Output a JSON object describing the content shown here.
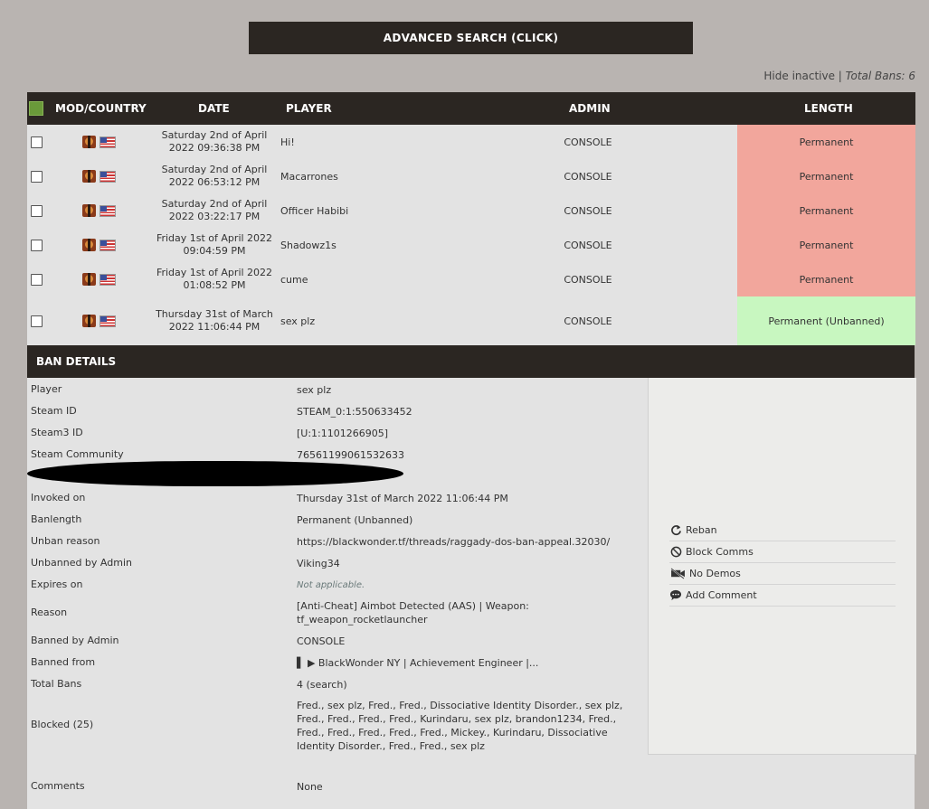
{
  "search": {
    "advanced_label": "ADVANCED SEARCH (CLICK)"
  },
  "topinfo": {
    "hide_inactive": "Hide inactive",
    "separator": " | ",
    "total_bans": "Total Bans: 6"
  },
  "table": {
    "headers": {
      "mod_country": "MOD/COUNTRY",
      "date": "DATE",
      "player": "PLAYER",
      "admin": "ADMIN",
      "length": "LENGTH"
    },
    "rows": [
      {
        "date": "Saturday 2nd of April 2022 09:36:38 PM",
        "player": "Hi!",
        "admin": "CONSOLE",
        "length": "Permanent"
      },
      {
        "date": "Saturday 2nd of April 2022 06:53:12 PM",
        "player": "Macarrones",
        "admin": "CONSOLE",
        "length": "Permanent"
      },
      {
        "date": "Saturday 2nd of April 2022 03:22:17 PM",
        "player": "Officer Habibi",
        "admin": "CONSOLE",
        "length": "Permanent"
      },
      {
        "date": "Friday 1st of April 2022 09:04:59 PM",
        "player": "Shadowz1s",
        "admin": "CONSOLE",
        "length": "Permanent"
      },
      {
        "date": "Friday 1st of April 2022 01:08:52 PM",
        "player": "cume",
        "admin": "CONSOLE",
        "length": "Permanent"
      },
      {
        "date": "Thursday 31st of March 2022 11:06:44 PM",
        "player": "sex plz",
        "admin": "CONSOLE",
        "length": "Permanent (Unbanned)"
      }
    ]
  },
  "ban_details": {
    "title": "BAN DETAILS",
    "player_label": "Player",
    "player": "sex plz",
    "steamid_label": "Steam ID",
    "steamid": "STEAM_0:1:550633452",
    "steam3_label": "Steam3 ID",
    "steam3": "[U:1:1101266905]",
    "community_label": "Steam Community",
    "community": "76561199061532633",
    "invoked_label": "Invoked on",
    "invoked": "Thursday 31st of March 2022 11:06:44 PM",
    "banlength_label": "Banlength",
    "banlength": "Permanent (Unbanned)",
    "unban_reason_label": "Unban reason",
    "unban_reason": "https://blackwonder.tf/threads/raggady-dos-ban-appeal.32030/",
    "unbanned_by_label": "Unbanned by Admin",
    "unbanned_by": "Viking34",
    "expires_label": "Expires on",
    "expires": "Not applicable.",
    "reason_label": "Reason",
    "reason": "[Anti-Cheat] Aimbot Detected (AAS) | Weapon: tf_weapon_rocketlauncher",
    "banned_by_label": "Banned by Admin",
    "banned_by": "CONSOLE",
    "banned_from_label": "Banned from",
    "banned_from": "▌ ▶ BlackWonder NY | Achievement Engineer |...",
    "total_bans_label": "Total Bans",
    "total_bans": "4 (search)",
    "blocked_label": "Blocked (25)",
    "blocked": "Fred., sex plz, Fred., Fred., Dissociative Identity Disorder., sex plz, Fred., Fred., Fred., Fred., Kurindaru, sex plz, brandon1234, Fred., Fred., Fred., Fred., Fred., Fred., Mickey., Kurindaru, Dissociative Identity Disorder., Fred., Fred., sex plz",
    "comments_label": "Comments",
    "comments": "None"
  },
  "actions": {
    "reban": "Reban",
    "block_comms": "Block Comms",
    "no_demos": "No Demos",
    "add_comment": "Add Comment"
  },
  "icons": [
    "mod-tf2-icon",
    "flag-us-icon",
    "reban-icon",
    "block-icon",
    "no-demos-icon",
    "comment-icon"
  ],
  "colors": {
    "header_bg": "#2b2622",
    "permanent_bg": "#f2a69c",
    "unbanned_bg": "#c8f7c0",
    "page_bg": "#b9b4b1"
  }
}
